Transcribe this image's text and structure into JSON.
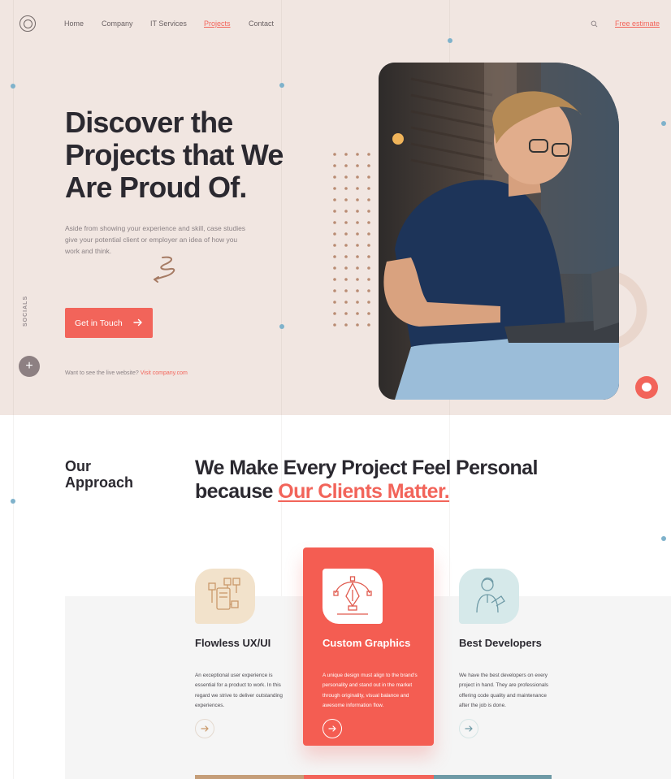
{
  "nav": {
    "items": [
      {
        "label": "Home",
        "active": false
      },
      {
        "label": "Company",
        "active": false
      },
      {
        "label": "IT Services",
        "active": false
      },
      {
        "label": "Projects",
        "active": true
      },
      {
        "label": "Contact",
        "active": false
      }
    ],
    "free_estimate": "Free estimate"
  },
  "hero": {
    "title": "Discover the Projects that We Are Proud Of.",
    "description": "Aside from showing your experience and skill, case studies give your potential client or employer an idea of how you work and think.",
    "cta_label": "Get in Touch",
    "socials_label": "SOCIALS",
    "live_prefix": "Want to see the live website? ",
    "live_link": "Visit company.com"
  },
  "approach": {
    "label": "Our Approach",
    "heading_part1": "We Make Every Project Feel Personal because ",
    "heading_accent": "Our Clients Matter.",
    "cards": [
      {
        "title": "Flowless UX/UI",
        "description": "An exceptional user experience is essential for a product to work. In this regard we strive to deliver outstanding experiences.",
        "icon": "ux-wireframe-icon"
      },
      {
        "title": "Custom Graphics",
        "description": "A unique design must align to the brand's personality and stand out in the market through originality, visual balance and awesome information flow.",
        "icon": "pen-tool-icon"
      },
      {
        "title": "Best Developers",
        "description": "We have the best developers on every project in hand. They are professionals offering code quality and maintenance after the job is done.",
        "icon": "developer-icon"
      }
    ]
  },
  "colors": {
    "accent": "#f2645a",
    "hero_bg": "#f1e6e1",
    "card1_icon_bg": "#f2e2cb",
    "card3_icon_bg": "#d6e9ea"
  }
}
